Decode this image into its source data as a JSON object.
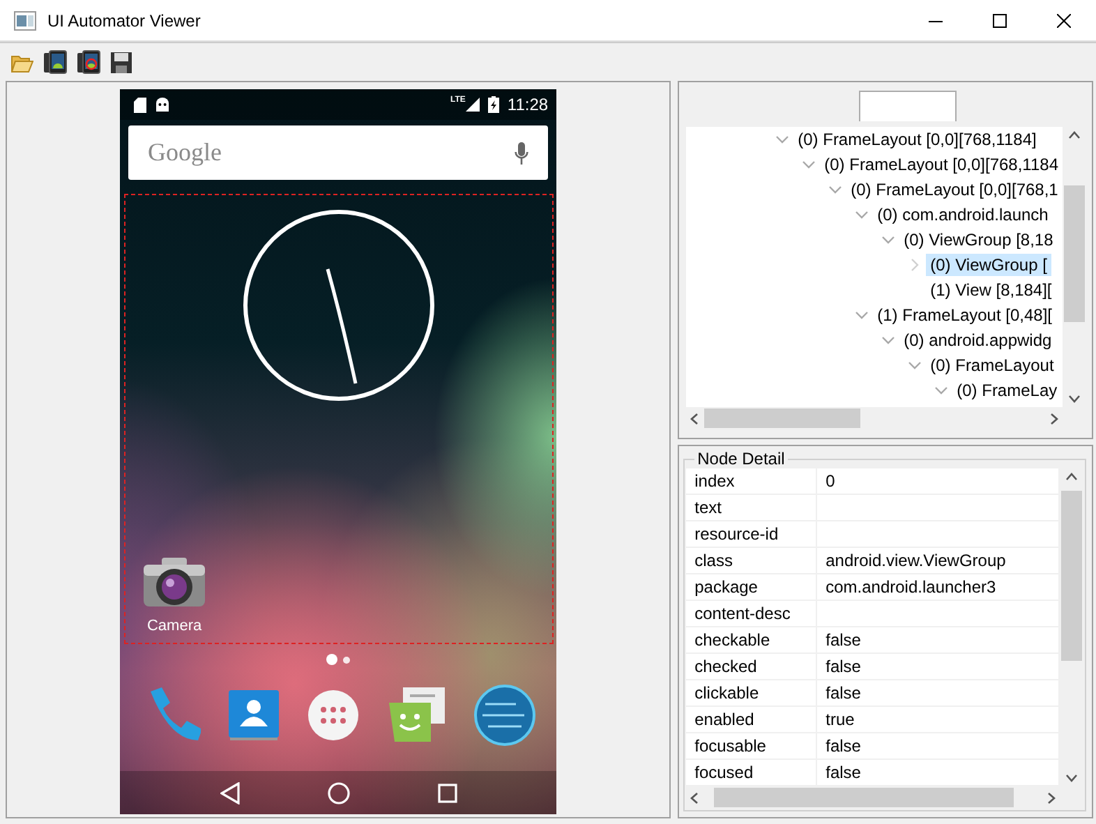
{
  "window": {
    "title": "UI Automator Viewer"
  },
  "device": {
    "status_bar": {
      "network": "LTE",
      "time": "11:28"
    },
    "search_bar": {
      "placeholder": "Google"
    },
    "apps": [
      {
        "label": "Camera"
      }
    ],
    "page_dots": [
      {
        "selected": true
      },
      {
        "selected": false
      }
    ]
  },
  "tree": {
    "nodes": [
      {
        "label": "(0) FrameLayout [0,0][768,1184]",
        "expanded": true,
        "selected": false,
        "children": [
          {
            "label": "(0) FrameLayout [0,0][768,1184",
            "expanded": true,
            "selected": false,
            "children": [
              {
                "label": "(0) FrameLayout [0,0][768,1",
                "expanded": true,
                "selected": false,
                "children": [
                  {
                    "label": "(0) com.android.launch",
                    "expanded": true,
                    "selected": false,
                    "children": [
                      {
                        "label": "(0) ViewGroup [8,18",
                        "expanded": true,
                        "selected": false,
                        "children": [
                          {
                            "label": "(0) ViewGroup [",
                            "expanded": false,
                            "selected": true
                          },
                          {
                            "label": "(1) View [8,184][",
                            "selected": false
                          }
                        ]
                      }
                    ]
                  },
                  {
                    "label": "(1) FrameLayout [0,48][",
                    "expanded": true,
                    "selected": false,
                    "children": [
                      {
                        "label": "(0) android.appwidg",
                        "expanded": true,
                        "selected": false,
                        "children": [
                          {
                            "label": "(0) FrameLayout",
                            "expanded": true,
                            "selected": false,
                            "children": [
                              {
                                "label": "(0) FrameLay",
                                "expanded": true,
                                "selected": false
                              }
                            ]
                          }
                        ]
                      }
                    ]
                  }
                ]
              }
            ]
          }
        ]
      }
    ]
  },
  "node_detail": {
    "title": "Node Detail",
    "properties": [
      {
        "name": "index",
        "value": "0"
      },
      {
        "name": "text"
      },
      {
        "name": "resource-id"
      },
      {
        "name": "class",
        "value": "android.view.ViewGroup"
      },
      {
        "name": "package",
        "value": "com.android.launcher3"
      },
      {
        "name": "content-desc"
      },
      {
        "name": "checkable",
        "value": "false"
      },
      {
        "name": "checked",
        "value": "false"
      },
      {
        "name": "clickable",
        "value": "false"
      },
      {
        "name": "enabled",
        "value": "true"
      },
      {
        "name": "focusable",
        "value": "false"
      },
      {
        "name": "focused",
        "value": "false"
      }
    ]
  }
}
